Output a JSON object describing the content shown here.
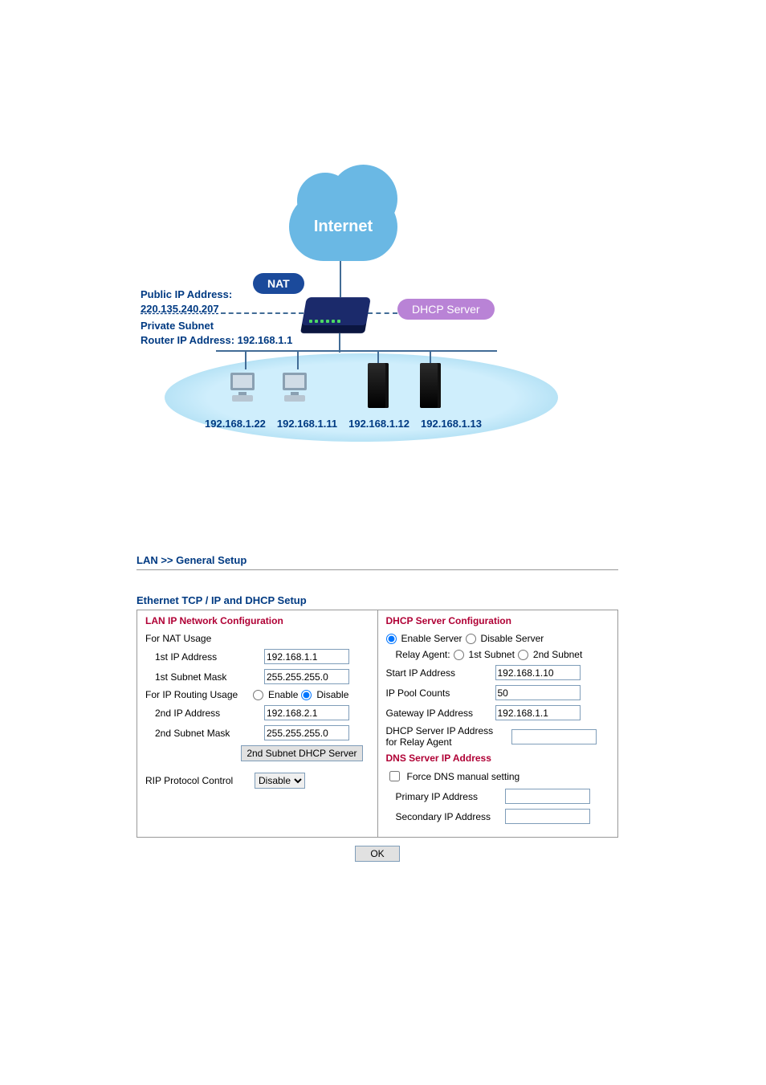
{
  "diagram": {
    "cloud_label": "Internet",
    "nat_label": "NAT",
    "dhcp_label": "DHCP Server",
    "public_ip_label": "Public IP Address:",
    "public_ip_value": "220.135.240.207",
    "private_subnet_label": "Private Subnet",
    "router_ip_full": "Router IP Address: 192.168.1.1",
    "host_ips": [
      "192.168.1.22",
      "192.168.1.11",
      "192.168.1.12",
      "192.168.1.13"
    ]
  },
  "breadcrumb": "LAN >> General Setup",
  "section_title": "Ethernet TCP / IP and DHCP Setup",
  "lan": {
    "title": "LAN IP Network Configuration",
    "for_nat_usage": "For NAT Usage",
    "first_ip_label": "1st IP Address",
    "first_ip_value": "192.168.1.1",
    "first_mask_label": "1st Subnet Mask",
    "first_mask_value": "255.255.255.0",
    "for_ip_routing": "For IP Routing Usage",
    "enable_label": "Enable",
    "disable_label": "Disable",
    "routing_selected": "disable",
    "second_ip_label": "2nd IP Address",
    "second_ip_value": "192.168.2.1",
    "second_mask_label": "2nd Subnet Mask",
    "second_mask_value": "255.255.255.0",
    "second_subnet_btn": "2nd Subnet DHCP Server",
    "rip_label": "RIP Protocol Control",
    "rip_value": "Disable"
  },
  "dhcp": {
    "title": "DHCP Server Configuration",
    "enable_server": "Enable Server",
    "disable_server": "Disable Server",
    "server_selected": "enable",
    "relay_agent_label": "Relay Agent:",
    "first_subnet": "1st Subnet",
    "second_subnet": "2nd Subnet",
    "start_ip_label": "Start IP Address",
    "start_ip_value": "192.168.1.10",
    "pool_counts_label": "IP Pool Counts",
    "pool_counts_value": "50",
    "gateway_label": "Gateway IP Address",
    "gateway_value": "192.168.1.1",
    "relay_ip_label_l1": "DHCP Server IP Address",
    "relay_ip_label_l2": "for Relay Agent",
    "relay_ip_value": "",
    "dns_title": "DNS Server IP Address",
    "force_dns_label": "Force DNS manual setting",
    "primary_label": "Primary IP Address",
    "primary_value": "",
    "secondary_label": "Secondary IP Address",
    "secondary_value": ""
  },
  "ok_label": "OK"
}
